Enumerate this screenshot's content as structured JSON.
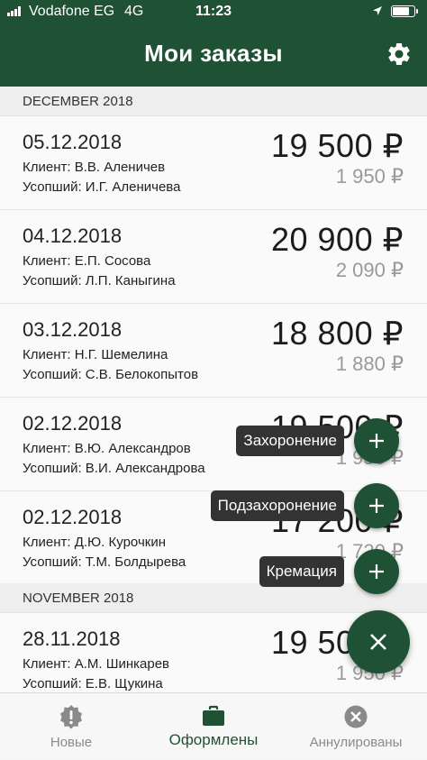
{
  "status_bar": {
    "carrier": "Vodafone EG",
    "network": "4G",
    "time": "11:23",
    "battery_level": 0.8
  },
  "header": {
    "title": "Мои заказы",
    "settings_icon": "gear-icon"
  },
  "sections": [
    {
      "label": "DECEMBER 2018",
      "orders": [
        {
          "date": "05.12.2018",
          "client": "Клиент: В.В. Аленичев",
          "deceased": "Усопший: И.Г. Аленичева",
          "total": "19 500 ₽",
          "fee": "1 950 ₽"
        },
        {
          "date": "04.12.2018",
          "client": "Клиент: Е.П. Сосова",
          "deceased": "Усопший: Л.П. Каныгина",
          "total": "20 900 ₽",
          "fee": "2 090 ₽"
        },
        {
          "date": "03.12.2018",
          "client": "Клиент: Н.Г. Шемелина",
          "deceased": "Усопший: С.В. Белокопытов",
          "total": "18 800 ₽",
          "fee": "1 880 ₽"
        },
        {
          "date": "02.12.2018",
          "client": "Клиент: В.Ю. Александров",
          "deceased": "Усопший: В.И. Александрова",
          "total": "19 500 ₽",
          "fee": "1 950 ₽"
        },
        {
          "date": "02.12.2018",
          "client": "Клиент: Д.Ю. Курочкин",
          "deceased": "Усопший: Т.М. Болдырева",
          "total": "17 200 ₽",
          "fee": "1 720 ₽"
        }
      ]
    },
    {
      "label": "NOVEMBER 2018",
      "orders": [
        {
          "date": "28.11.2018",
          "client": "Клиент: А.М. Шинкарев",
          "deceased": "Усопший: Е.В. Щукина",
          "total": "19 500 ₽",
          "fee": "1 950 ₽"
        }
      ]
    }
  ],
  "fab_menu": {
    "items": [
      {
        "label": "Захоронение",
        "icon": "plus-icon"
      },
      {
        "label": "Подзахоронение",
        "icon": "plus-icon"
      },
      {
        "label": "Кремация",
        "icon": "plus-icon"
      }
    ],
    "close_icon": "close-icon"
  },
  "bottom_nav": {
    "tabs": [
      {
        "label": "Новые",
        "icon": "alert-badge-icon",
        "active": false
      },
      {
        "label": "Оформлены",
        "icon": "briefcase-icon",
        "active": true
      },
      {
        "label": "Аннулированы",
        "icon": "cancel-circle-icon",
        "active": false
      }
    ]
  },
  "colors": {
    "primary": "#1f5234",
    "tooltip": "#333333",
    "muted_text": "#9a9a9a"
  }
}
